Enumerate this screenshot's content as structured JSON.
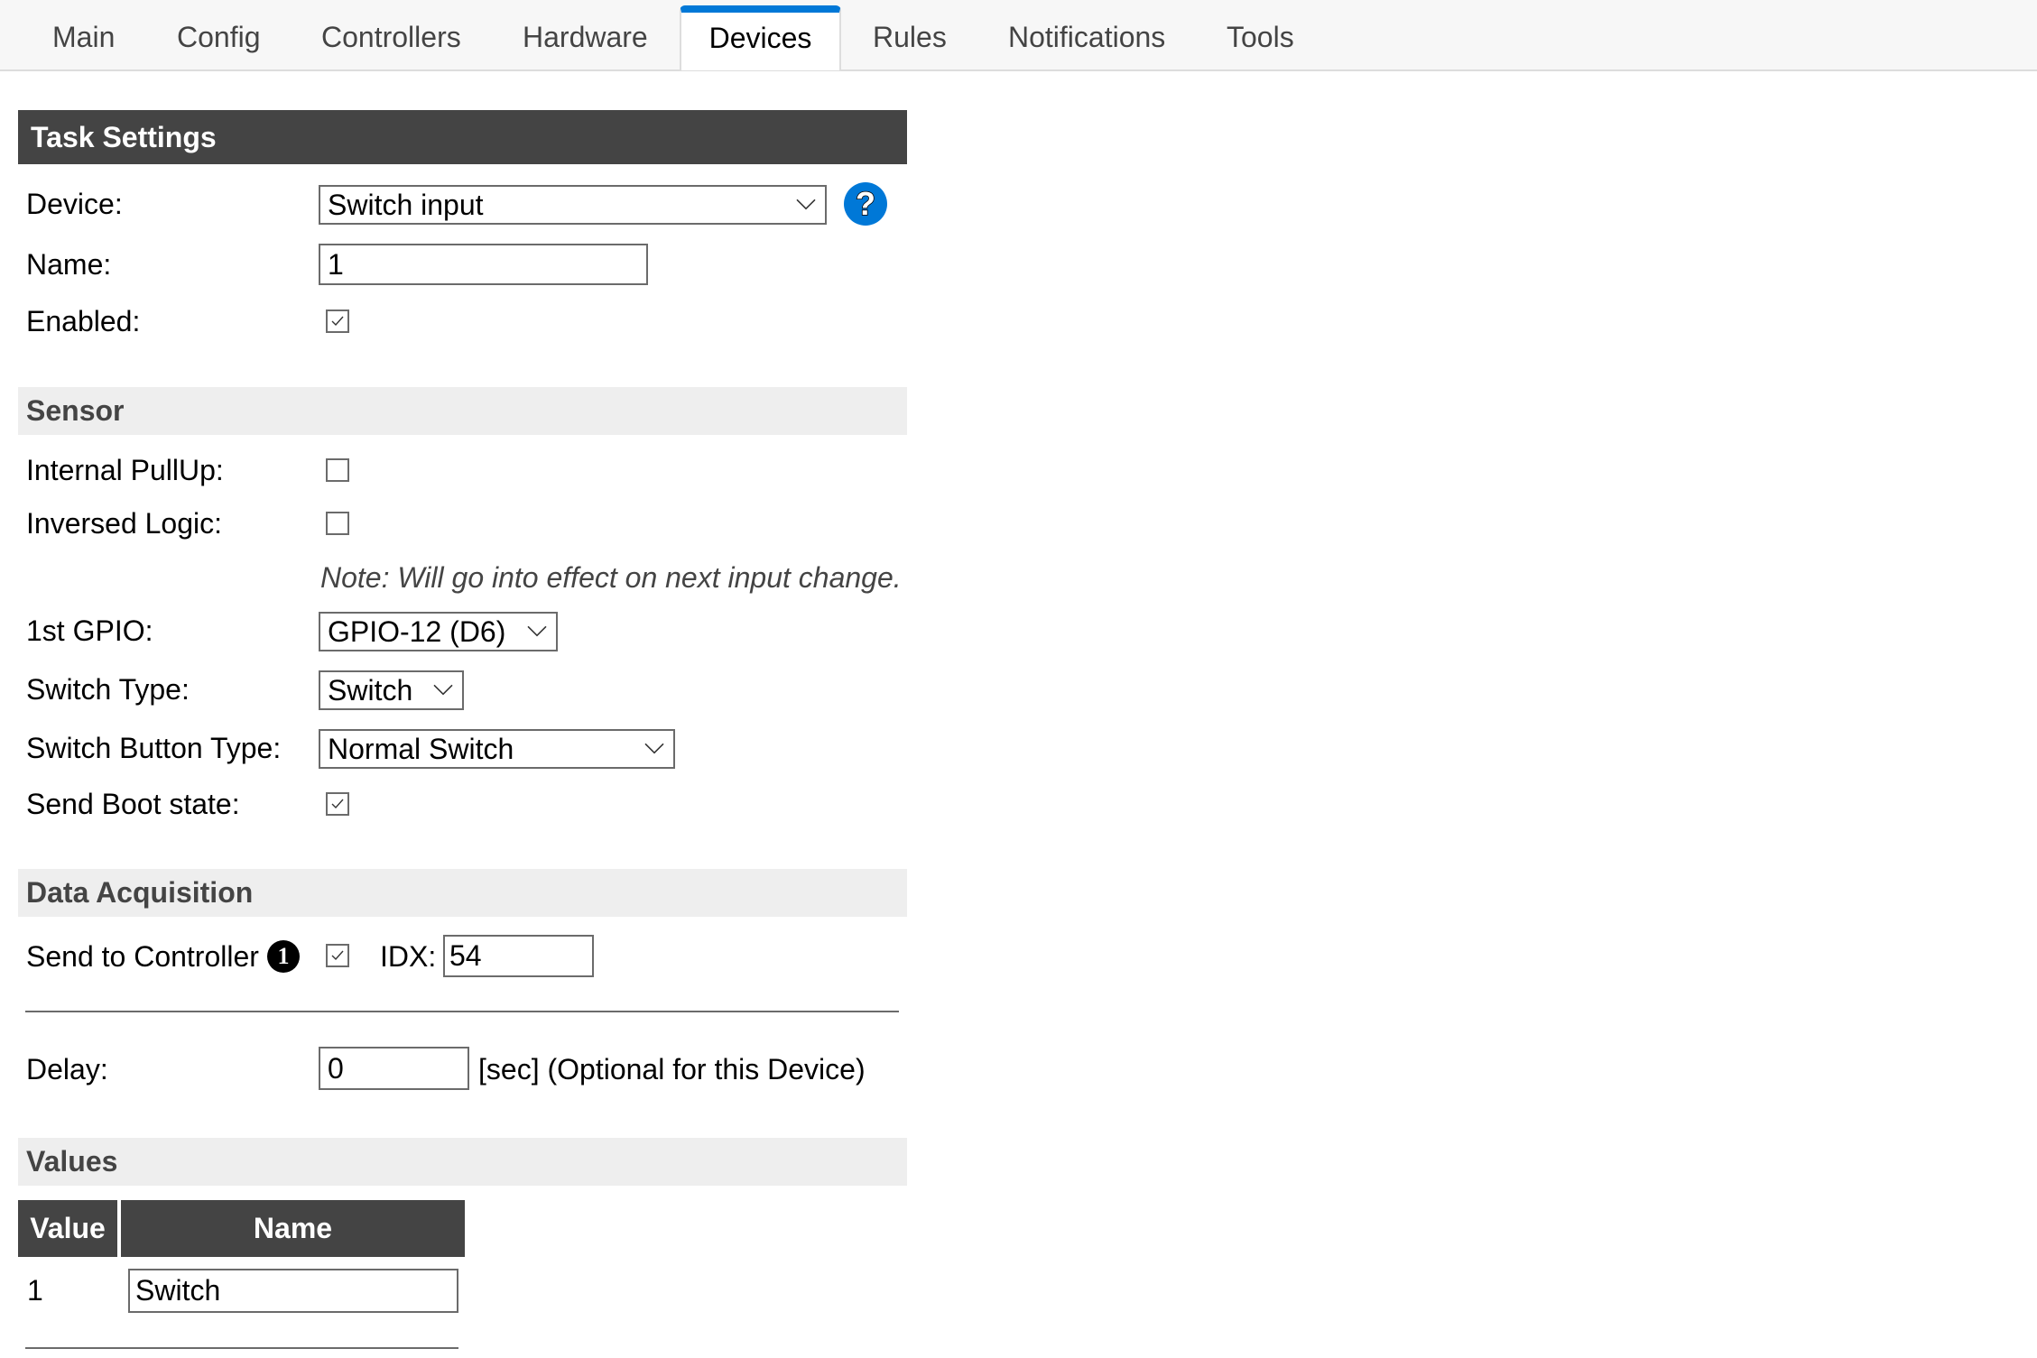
{
  "nav": {
    "tabs": [
      {
        "label": "Main",
        "active": false
      },
      {
        "label": "Config",
        "active": false
      },
      {
        "label": "Controllers",
        "active": false
      },
      {
        "label": "Hardware",
        "active": false
      },
      {
        "label": "Devices",
        "active": true
      },
      {
        "label": "Rules",
        "active": false
      },
      {
        "label": "Notifications",
        "active": false
      },
      {
        "label": "Tools",
        "active": false
      }
    ]
  },
  "accent_color": "#0078d7",
  "task_settings": {
    "title": "Task Settings",
    "device_label": "Device:",
    "device_value": "Switch input",
    "help_icon": "help-icon",
    "name_label": "Name:",
    "name_value": "1",
    "enabled_label": "Enabled:",
    "enabled_checked": true
  },
  "sensor": {
    "title": "Sensor",
    "internal_pullup_label": "Internal PullUp:",
    "internal_pullup_checked": false,
    "inversed_logic_label": "Inversed Logic:",
    "inversed_logic_checked": false,
    "note": "Note: Will go into effect on next input change.",
    "gpio_label": "1st GPIO:",
    "gpio_value": "GPIO-12 (D6)",
    "switch_type_label": "Switch Type:",
    "switch_type_value": "Switch",
    "switch_button_type_label": "Switch Button Type:",
    "switch_button_type_value": "Normal Switch",
    "send_boot_state_label": "Send Boot state:",
    "send_boot_state_checked": true
  },
  "data_acquisition": {
    "title": "Data Acquisition",
    "send_to_controller_label": "Send to Controller",
    "controller_badge": "1",
    "send_to_controller_checked": true,
    "idx_label": "IDX:",
    "idx_value": "54",
    "delay_label": "Delay:",
    "delay_value": "0",
    "delay_suffix": "[sec] (Optional for this Device)"
  },
  "values": {
    "title": "Values",
    "columns": [
      "Value",
      "Name"
    ],
    "rows": [
      {
        "value": "1",
        "name": "Switch"
      }
    ]
  }
}
